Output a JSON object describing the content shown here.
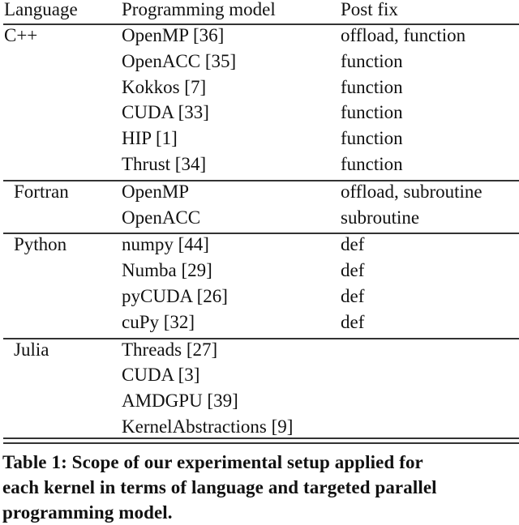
{
  "table": {
    "headers": [
      "Language",
      "Programming model",
      "Post fix"
    ],
    "groups": [
      {
        "language": "C++",
        "rows": [
          {
            "model": "OpenMP [36]",
            "postfix": "offload, function"
          },
          {
            "model": "OpenACC [35]",
            "postfix": "function"
          },
          {
            "model": "Kokkos [7]",
            "postfix": "function"
          },
          {
            "model": "CUDA [33]",
            "postfix": "function"
          },
          {
            "model": "HIP [1]",
            "postfix": "function"
          },
          {
            "model": "Thrust [34]",
            "postfix": "function"
          }
        ]
      },
      {
        "language": "Fortran",
        "rows": [
          {
            "model": "OpenMP",
            "postfix": "offload, subroutine"
          },
          {
            "model": "OpenACC",
            "postfix": "subroutine"
          }
        ]
      },
      {
        "language": "Python",
        "rows": [
          {
            "model": "numpy [44]",
            "postfix": "def"
          },
          {
            "model": "Numba [29]",
            "postfix": "def"
          },
          {
            "model": "pyCUDA [26]",
            "postfix": "def"
          },
          {
            "model": "cuPy [32]",
            "postfix": "def"
          }
        ]
      },
      {
        "language": "Julia",
        "rows": [
          {
            "model": "Threads [27]",
            "postfix": ""
          },
          {
            "model": "CUDA [3]",
            "postfix": ""
          },
          {
            "model": "AMDGPU [39]",
            "postfix": ""
          },
          {
            "model": "KernelAbstractions [9]",
            "postfix": ""
          }
        ]
      }
    ]
  },
  "caption": {
    "lines": [
      "Table 1: Scope of our experimental setup applied for",
      "each kernel in terms of language and targeted parallel",
      "programming model."
    ]
  }
}
